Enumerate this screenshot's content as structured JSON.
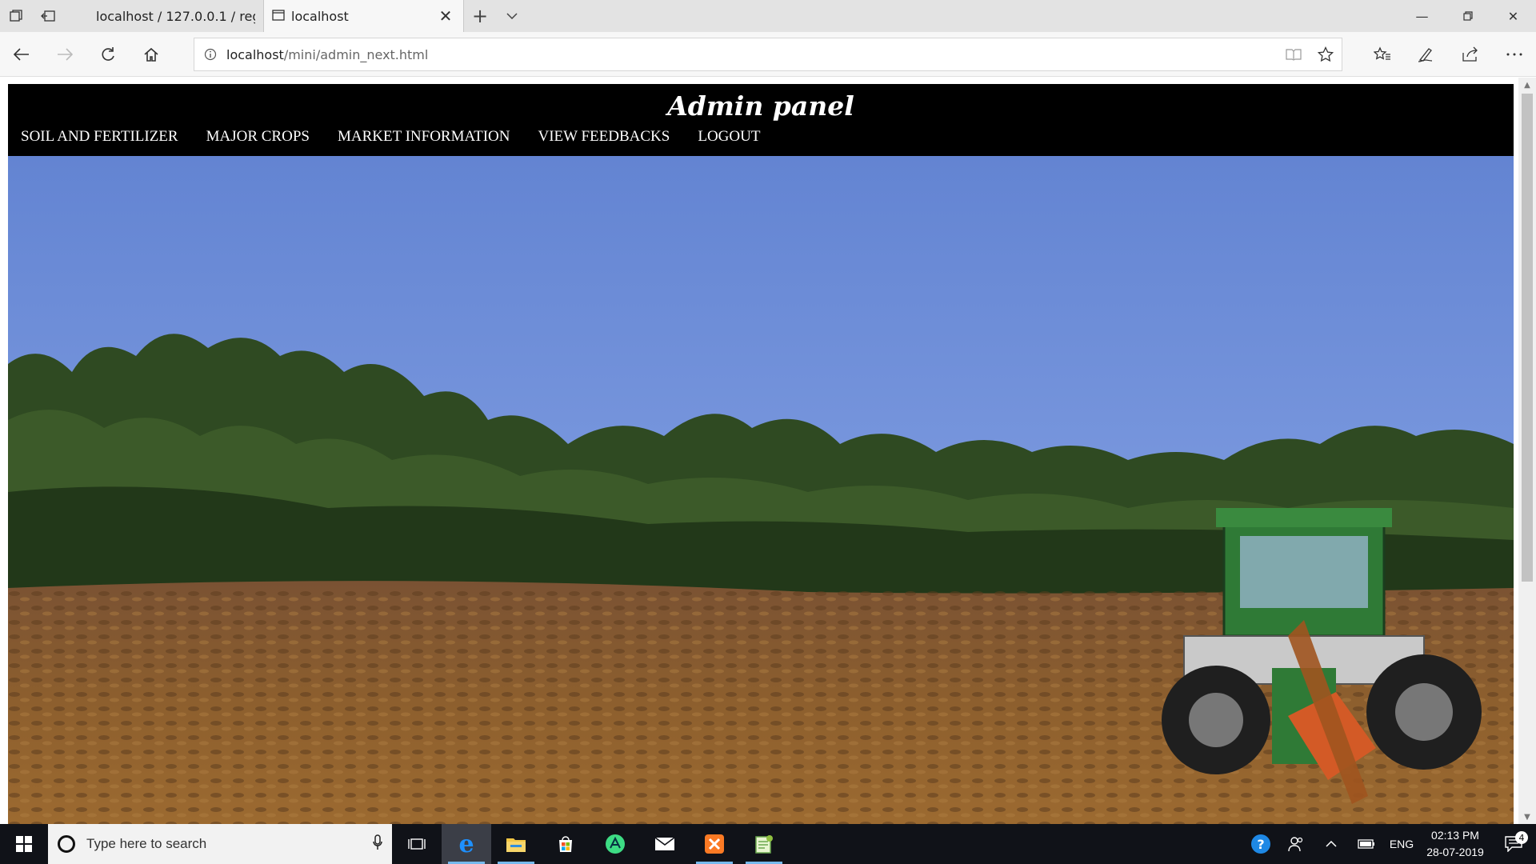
{
  "browser": {
    "tabs": [
      {
        "title": "localhost / 127.0.0.1 / regist",
        "active": false
      },
      {
        "title": "localhost",
        "active": true
      }
    ],
    "url_host": "localhost",
    "url_path": "/mini/admin_next.html"
  },
  "page": {
    "title": "Admin panel",
    "nav": [
      "SOIL AND FERTILIZER",
      "MAJOR CROPS",
      "MARKET INFORMATION",
      "VIEW FEEDBACKS",
      "LOGOUT"
    ],
    "hero_alt": "Tractor ploughing a field"
  },
  "taskbar": {
    "search_placeholder": "Type here to search",
    "language": "ENG",
    "time": "02:13 PM",
    "date": "28-07-2019",
    "notification_count": "4"
  },
  "colors": {
    "header_bg": "#000000",
    "sky": "#6f8fd6",
    "soil": "#8a5a2a",
    "taskbar_bg": "#101218"
  },
  "scroll": {
    "position_fraction": 0.0
  }
}
